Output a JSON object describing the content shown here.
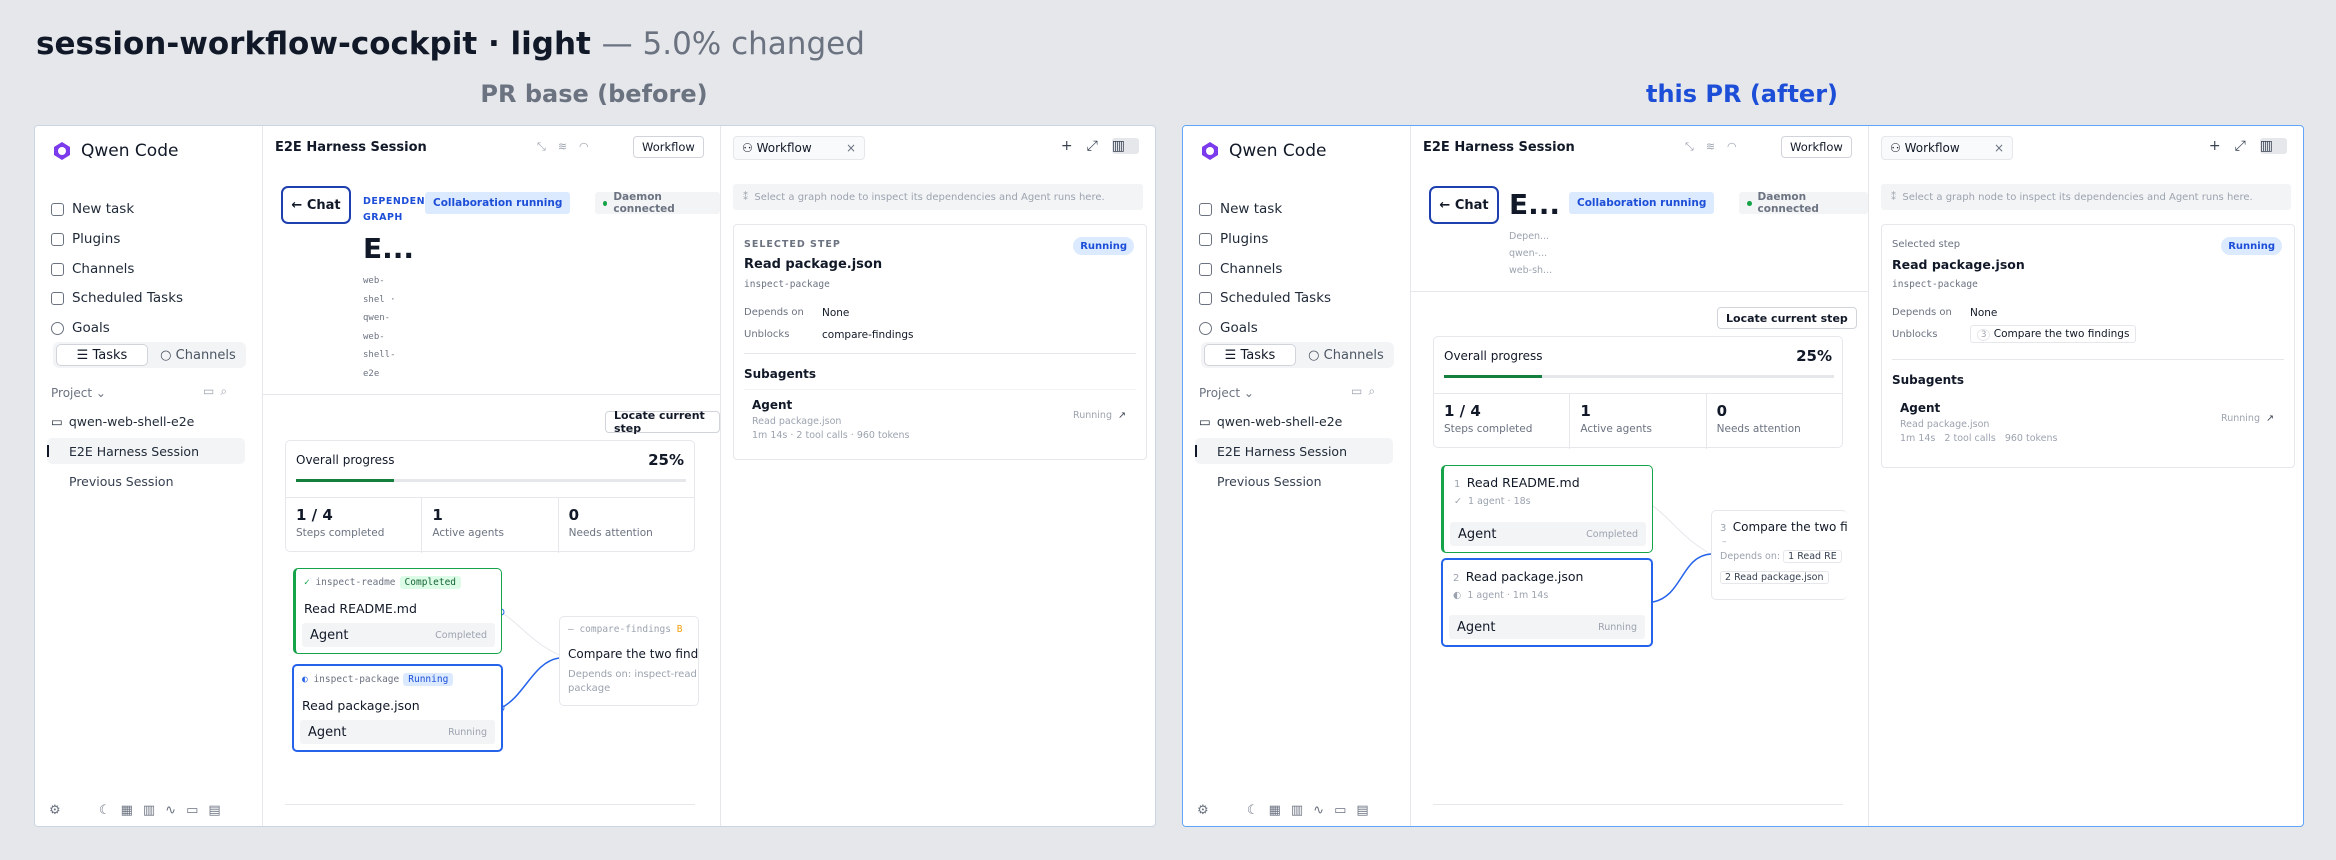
{
  "page": {
    "title": "session-workflow-cockpit · light",
    "subtitle": "— 5.0% changed"
  },
  "labels": {
    "before": "PR base (before)",
    "after": "this PR (after)"
  },
  "common": {
    "brand": "Qwen Code",
    "nav": [
      "New task",
      "Plugins",
      "Channels",
      "Scheduled Tasks",
      "Goals"
    ],
    "tab_tasks": "Tasks",
    "tab_channels": "Channels",
    "project_label": "Project",
    "repo": "qwen-web-shell-e2e",
    "sessions": [
      "E2E Harness Session",
      "Previous Session"
    ],
    "session_title": "E2E Harness Session",
    "workflow_btn": "Workflow",
    "chat_btn": "Chat",
    "collab": "Collaboration running",
    "daemon": "Daemon connected",
    "locate": "Locate current step",
    "overall": "Overall progress",
    "percent": "25%",
    "progress_fraction": 0.25,
    "steps_v": "1 / 4",
    "steps_l": "Steps completed",
    "agents_v": "1",
    "agents_l": "Active agents",
    "attn_v": "0",
    "attn_l": "Needs attention",
    "agent": "Agent",
    "completed": "Completed",
    "running": "Running",
    "readme": "Read README.md",
    "package": "Read package.json",
    "compare": "Compare the two findings",
    "rtab": "Workflow",
    "hint": "Select a graph node to inspect its dependencies and Agent runs here.",
    "depends_k": "Depends on",
    "depends_v": "None",
    "unblocks_k": "Unblocks",
    "subagents": "Subagents",
    "sub_name": "Agent",
    "sub_file": "Read package.json"
  },
  "before": {
    "dep_graph": "DEPENDENCY GRAPH",
    "big_title": "E...",
    "mono_lines": [
      "web-",
      "shel ·",
      "qwen-",
      "web-",
      "shell-",
      "e2e"
    ],
    "id_readme": "inspect-readme",
    "id_package": "inspect-package",
    "id_compare": "compare-findings",
    "compare_trunc": "Compare the two findi",
    "compare_dep": "Depends on: inspect-read",
    "compare_dep2": "package",
    "selected": "SELECTED STEP",
    "step_id": "inspect-package",
    "unblocks_v": "compare-findings",
    "sub_meta": "1m 14s · 2 tool calls · 960 tokens"
  },
  "after": {
    "big_title": "E...",
    "meta_lines": [
      "Depen...",
      "qwen-...",
      "web-sh..."
    ],
    "readme_meta": "1 agent · 18s",
    "package_meta": "1 agent · 1m 14s",
    "compare_trunc": "Compare the two fi",
    "compare_dep_label": "Depends on:",
    "chip_readme": "Read RE",
    "chip_package": "Read package.json",
    "selected": "Selected step",
    "step_id": "inspect-package",
    "unblocks_num": "3",
    "unblocks_v": "Compare the two findings",
    "sub_meta": "1m 14s   2 tool calls   960 tokens"
  }
}
